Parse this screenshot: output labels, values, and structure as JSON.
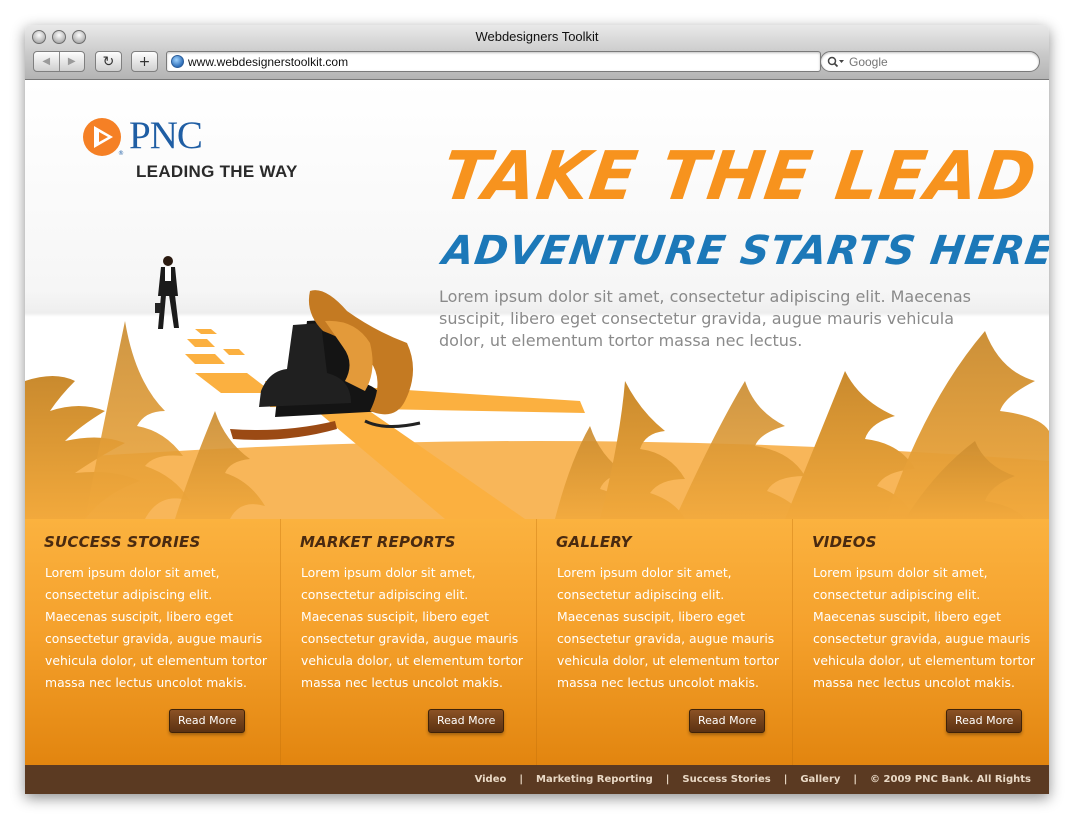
{
  "browser": {
    "title": "Webdesigners Toolkit",
    "url": "www.webdesignerstoolkit.com",
    "search_placeholder": "Google",
    "back_icon": "back-arrow-icon",
    "forward_icon": "forward-arrow-icon",
    "reload_icon": "reload-icon",
    "add_icon": "plus-icon"
  },
  "brand": {
    "logo_word": "PNC",
    "tagline": "LEADING THE WAY",
    "orange": "#f7931e",
    "blue": "#1c78b8"
  },
  "hero": {
    "headline": "Take the Lead",
    "subhead": "Adventure Starts Here",
    "intro": "Lorem ipsum dolor sit amet, consectetur adipiscing elit. Maecenas suscipit, libero eget consectetur gravida, augue mauris vehicula dolor, ut elementum tortor massa nec lectus."
  },
  "features": [
    {
      "title": "Success Stories",
      "text": "Lorem ipsum dolor sit amet, consectetur adipiscing elit. Maecenas suscipit, libero eget consectetur gravida, augue mauris vehicula dolor, ut elementum tortor massa nec lectus uncolot makis.",
      "button": "Read More"
    },
    {
      "title": "Market Reports",
      "text": "Lorem ipsum dolor sit amet, consectetur adipiscing elit. Maecenas suscipit, libero eget consectetur gravida, augue mauris vehicula dolor, ut elementum tortor massa nec lectus uncolot makis.",
      "button": "Read More"
    },
    {
      "title": "Gallery",
      "text": "Lorem ipsum dolor sit amet, consectetur adipiscing elit. Maecenas suscipit, libero eget consectetur gravida, augue mauris vehicula dolor, ut elementum tortor massa nec lectus uncolot makis.",
      "button": "Read More"
    },
    {
      "title": "Videos",
      "text": "Lorem ipsum dolor sit amet, consectetur adipiscing elit. Maecenas suscipit, libero eget consectetur gravida, augue mauris vehicula dolor, ut elementum tortor massa nec lectus uncolot makis.",
      "button": "Read More"
    }
  ],
  "footer": {
    "links": [
      "Video",
      "Marketing Reporting",
      "Success Stories",
      "Gallery"
    ],
    "separator": "|",
    "copyright": "© 2009 PNC Bank. All Rights"
  }
}
